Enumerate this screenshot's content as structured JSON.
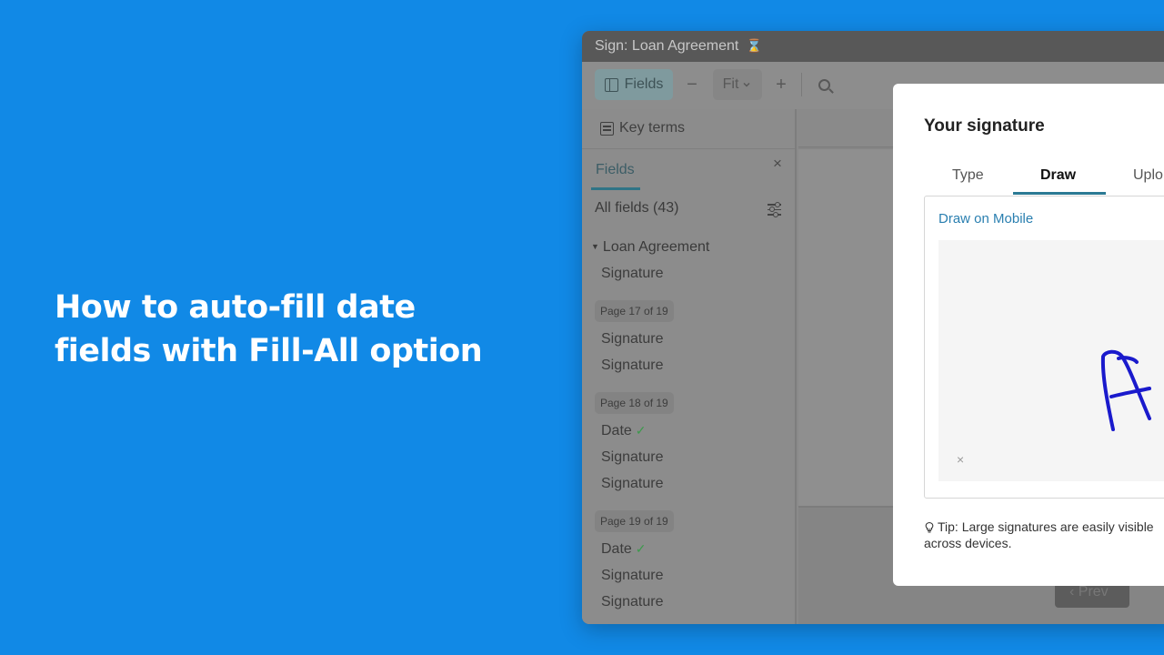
{
  "headline": {
    "line1": "How to auto-fill date",
    "line2": "fields with Fill-All option"
  },
  "window": {
    "title": "Sign: Loan Agreement"
  },
  "toolbar": {
    "fields_label": "Fields",
    "minus": "−",
    "zoom_label": "Fit",
    "plus": "+"
  },
  "sidebar": {
    "key_terms": "Key terms",
    "tab_fields": "Fields",
    "close": "×",
    "all_fields": "All fields (43)",
    "group_name": "Loan Agreement",
    "first_item": "Signature",
    "pages": [
      {
        "badge": "Page 17 of 19",
        "items": [
          "Signature",
          "Signature"
        ]
      },
      {
        "badge": "Page 18 of 19",
        "items": [
          "Date",
          "Signature",
          "Signature"
        ]
      },
      {
        "badge": "Page 19 of 19",
        "items": [
          "Date",
          "Signature",
          "Signature"
        ]
      }
    ],
    "check_mark": "✓"
  },
  "doc": {
    "prev_label": "Prev"
  },
  "modal": {
    "title": "Your signature",
    "tabs": [
      "Type",
      "Draw",
      "Uplo"
    ],
    "active_tab": "Draw",
    "draw_on_mobile": "Draw on Mobile",
    "clear": "×",
    "tip_line1": "Tip: Large signatures are easily visible",
    "tip_line2": "across devices."
  },
  "colors": {
    "background": "#1189e6",
    "accent": "#2b7a94",
    "link": "#2a7fb0",
    "ink": "#1a1acc"
  }
}
